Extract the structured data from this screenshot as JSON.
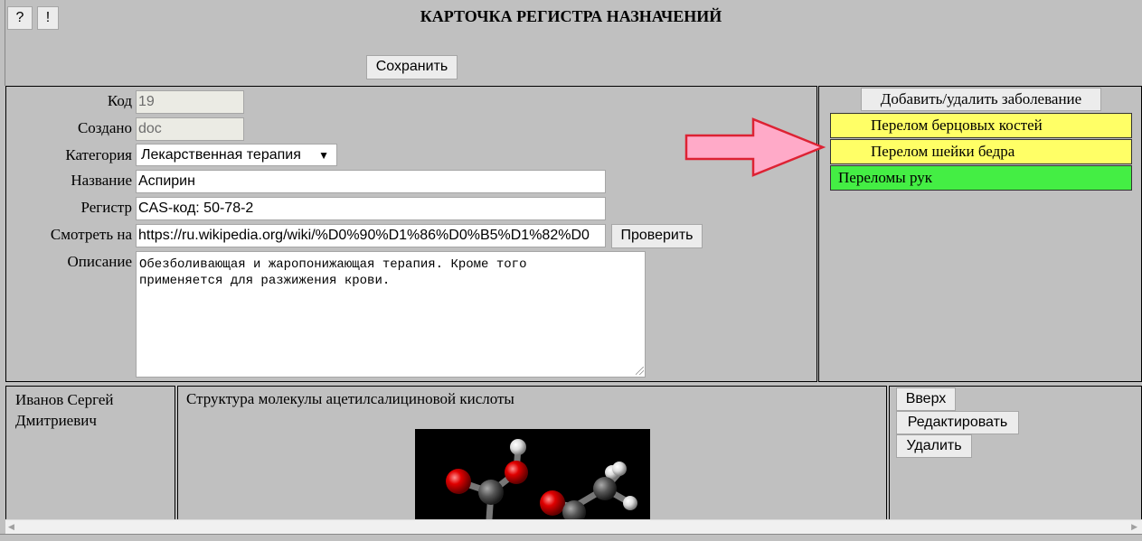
{
  "header": {
    "help_label": "?",
    "alert_label": "!",
    "title": "КАРТОЧКА РЕГИСТРА НАЗНАЧЕНИЙ",
    "save_label": "Сохранить"
  },
  "form": {
    "code": {
      "label": "Код",
      "value": "19"
    },
    "created": {
      "label": "Создано",
      "value": "doc"
    },
    "category": {
      "label": "Категория",
      "value": "Лекарственная терапия"
    },
    "name": {
      "label": "Название",
      "value": "Аспирин"
    },
    "register": {
      "label": "Регистр",
      "value": "CAS-код: 50-78-2"
    },
    "see_at": {
      "label": "Смотреть на",
      "value": "https://ru.wikipedia.org/wiki/%D0%90%D1%86%D0%B5%D1%82%D0",
      "check_label": "Проверить"
    },
    "description": {
      "label": "Описание",
      "value": "Обезболивающая и жаропонижающая терапия. Кроме того\nприменяется для разжижения крови."
    }
  },
  "diseases": {
    "add_remove_label": "Добавить/удалить заболевание",
    "items": [
      {
        "label": "Перелом берцовых костей",
        "color": "#ffff66"
      },
      {
        "label": "Перелом шейки бедра",
        "color": "#ffff66"
      },
      {
        "label": "Переломы рук",
        "color": "#44ee44"
      }
    ],
    "arrow_color": "#ffaac8"
  },
  "author": {
    "name_line1": "Иванов Сергей",
    "name_line2": "Дмитриевич"
  },
  "structure": {
    "caption": "Структура молекулы ацетилсалициновой кислоты"
  },
  "actions": {
    "up_label": "Вверх",
    "edit_label": "Редактировать",
    "delete_label": "Удалить"
  }
}
